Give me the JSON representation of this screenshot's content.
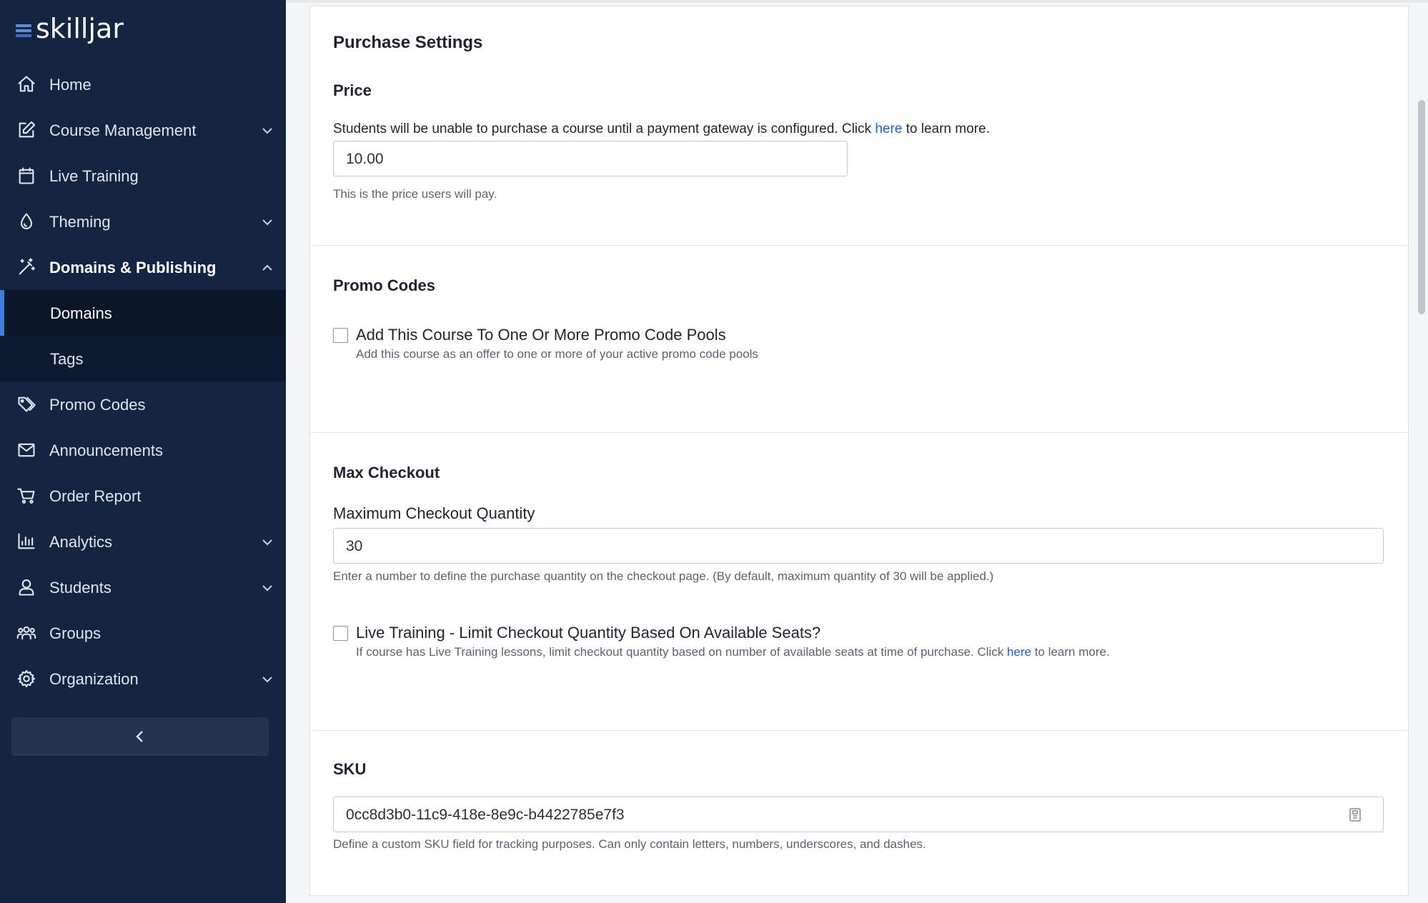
{
  "brand": {
    "logo_text": "skilljar"
  },
  "sidebar": {
    "items": [
      {
        "label": "Home",
        "icon": "home-icon"
      },
      {
        "label": "Course Management",
        "icon": "edit-icon",
        "expandable": true
      },
      {
        "label": "Live Training",
        "icon": "calendar-icon"
      },
      {
        "label": "Theming",
        "icon": "droplet-icon",
        "expandable": true
      },
      {
        "label": "Domains & Publishing",
        "icon": "wand-icon",
        "expandable": true,
        "expanded": true
      },
      {
        "label": "Promo Codes",
        "icon": "tag-icon"
      },
      {
        "label": "Announcements",
        "icon": "mail-icon"
      },
      {
        "label": "Order Report",
        "icon": "cart-icon"
      },
      {
        "label": "Analytics",
        "icon": "bar-chart-icon",
        "expandable": true
      },
      {
        "label": "Students",
        "icon": "user-icon",
        "expandable": true
      },
      {
        "label": "Groups",
        "icon": "users-icon"
      },
      {
        "label": "Organization",
        "icon": "gear-icon",
        "expandable": true
      }
    ],
    "subitems": [
      {
        "label": "Domains",
        "active": true
      },
      {
        "label": "Tags",
        "active": false
      }
    ],
    "collapse_icon": "chevron-left-icon"
  },
  "purchase": {
    "title": "Purchase Settings",
    "price_heading": "Price",
    "price_desc_pre": "Students will be unable to purchase a course until a payment gateway is configured. Click ",
    "price_desc_link": "here",
    "price_desc_post": " to learn more.",
    "price_value": "10.00",
    "price_help": "This is the price users will pay."
  },
  "promo": {
    "heading": "Promo Codes",
    "checkbox_label": "Add This Course To One Or More Promo Code Pools",
    "checkbox_help": "Add this course as an offer to one or more of your active promo code pools",
    "checked": false
  },
  "max_checkout": {
    "heading": "Max Checkout",
    "field_label": "Maximum Checkout Quantity",
    "value": "30",
    "help": "Enter a number to define the purchase quantity on the checkout page. (By default, maximum quantity of 30 will be applied.)",
    "live_label": "Live Training - Limit Checkout Quantity Based On Available Seats?",
    "live_help_pre": "If course has Live Training lessons, limit checkout quantity based on number of available seats at time of purchase. Click ",
    "live_help_link": "here",
    "live_help_post": " to learn more.",
    "live_checked": false
  },
  "sku": {
    "heading": "SKU",
    "value": "0cc8d3b0-11c9-418e-8e9c-b4422785e7f3",
    "help": "Define a custom SKU field for tracking purposes. Can only contain letters, numbers, underscores, and dashes.",
    "icon": "clipboard-icon"
  }
}
